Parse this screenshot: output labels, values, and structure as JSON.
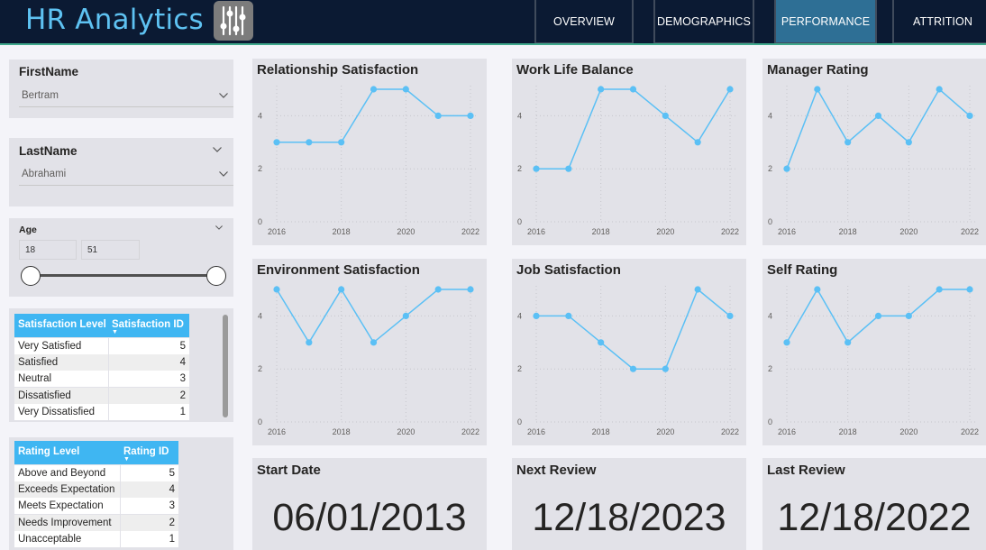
{
  "header": {
    "title": "HR Analytics",
    "logo_icon": "sliders-icon",
    "nav": [
      {
        "label": "OVERVIEW",
        "active": false
      },
      {
        "label": "DEMOGRAPHICS",
        "active": false
      },
      {
        "label": "PERFORMANCE",
        "active": true
      },
      {
        "label": "ATTRITION",
        "active": false
      }
    ]
  },
  "colors": {
    "accent": "#3fb6f2",
    "header_bg": "#0b1a33",
    "active_tab": "#2e6f95",
    "line": "#5bc0f5"
  },
  "filters": {
    "first_name": {
      "title": "FirstName",
      "value": "Bertram"
    },
    "last_name": {
      "title": "LastName",
      "value": "Abrahami"
    },
    "age": {
      "title": "Age",
      "min": "18",
      "max": "51"
    }
  },
  "satisfaction_table": {
    "headers": [
      "Satisfaction Level",
      "Satisfaction ID"
    ],
    "rows": [
      [
        "Very Satisfied",
        "5"
      ],
      [
        "Satisfied",
        "4"
      ],
      [
        "Neutral",
        "3"
      ],
      [
        "Dissatisfied",
        "2"
      ],
      [
        "Very Dissatisfied",
        "1"
      ]
    ]
  },
  "rating_table": {
    "headers": [
      "Rating Level",
      "Rating ID"
    ],
    "rows": [
      [
        "Above and Beyond",
        "5"
      ],
      [
        "Exceeds Expectation",
        "4"
      ],
      [
        "Meets Expectation",
        "3"
      ],
      [
        "Needs Improvement",
        "2"
      ],
      [
        "Unacceptable",
        "1"
      ]
    ]
  },
  "chart_data": [
    {
      "type": "line",
      "title": "Relationship Satisfaction",
      "x": [
        2016,
        2017,
        2018,
        2019,
        2020,
        2021,
        2022
      ],
      "values": [
        3,
        3,
        3,
        5,
        5,
        4,
        4
      ],
      "ylim": [
        0,
        5
      ],
      "yticks": [
        "0",
        "2",
        "4"
      ],
      "xticks": [
        "2016",
        "2018",
        "2020",
        "2022"
      ],
      "grid": true
    },
    {
      "type": "line",
      "title": "Work Life Balance",
      "x": [
        2016,
        2017,
        2018,
        2019,
        2020,
        2021,
        2022
      ],
      "values": [
        2,
        2,
        5,
        5,
        4,
        3,
        5
      ],
      "ylim": [
        0,
        5
      ],
      "yticks": [
        "0",
        "2",
        "4"
      ],
      "xticks": [
        "2016",
        "2018",
        "2020",
        "2022"
      ],
      "grid": true
    },
    {
      "type": "line",
      "title": "Manager Rating",
      "x": [
        2016,
        2017,
        2018,
        2019,
        2020,
        2021,
        2022
      ],
      "values": [
        2,
        5,
        3,
        4,
        3,
        5,
        4
      ],
      "ylim": [
        0,
        5
      ],
      "yticks": [
        "0",
        "2",
        "4"
      ],
      "xticks": [
        "2016",
        "2018",
        "2020",
        "2022"
      ],
      "grid": true
    },
    {
      "type": "line",
      "title": "Environment Satisfaction",
      "x": [
        2016,
        2017,
        2018,
        2019,
        2020,
        2021,
        2022
      ],
      "values": [
        5,
        3,
        5,
        3,
        4,
        5,
        5
      ],
      "ylim": [
        0,
        5
      ],
      "yticks": [
        "0",
        "2",
        "4"
      ],
      "xticks": [
        "2016",
        "2018",
        "2020",
        "2022"
      ],
      "grid": true
    },
    {
      "type": "line",
      "title": "Job Satisfaction",
      "x": [
        2016,
        2017,
        2018,
        2019,
        2020,
        2021,
        2022
      ],
      "values": [
        4,
        4,
        3,
        2,
        2,
        5,
        4
      ],
      "ylim": [
        0,
        5
      ],
      "yticks": [
        "0",
        "2",
        "4"
      ],
      "xticks": [
        "2016",
        "2018",
        "2020",
        "2022"
      ],
      "grid": true
    },
    {
      "type": "line",
      "title": "Self Rating",
      "x": [
        2016,
        2017,
        2018,
        2019,
        2020,
        2021,
        2022
      ],
      "values": [
        3,
        5,
        3,
        4,
        4,
        5,
        5
      ],
      "ylim": [
        0,
        5
      ],
      "yticks": [
        "0",
        "2",
        "4"
      ],
      "xticks": [
        "2016",
        "2018",
        "2020",
        "2022"
      ],
      "grid": true
    }
  ],
  "kpis": [
    {
      "title": "Start Date",
      "value": "06/01/2013"
    },
    {
      "title": "Next Review",
      "value": "12/18/2023"
    },
    {
      "title": "Last Review",
      "value": "12/18/2022"
    }
  ]
}
